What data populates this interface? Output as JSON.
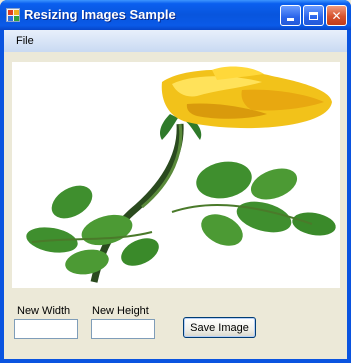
{
  "window": {
    "title": "Resizing Images Sample"
  },
  "menu": {
    "items": [
      "File"
    ]
  },
  "picture": {
    "description_icon": "yellow-rose-image"
  },
  "form": {
    "new_width_label": "New Width",
    "new_height_label": "New Height",
    "new_width_value": "",
    "new_height_value": "",
    "save_button_label": "Save Image"
  },
  "colors": {
    "titlebar": "#0a5fef",
    "client_bg": "#ece9d8",
    "close_button": "#d6522e"
  }
}
